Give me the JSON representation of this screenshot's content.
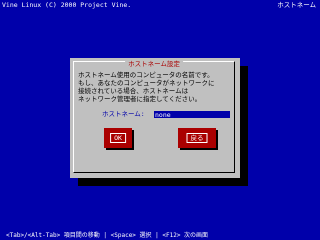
{
  "top_bar": {
    "left_text": "Vine Linux (C) 2000 Project Vine.",
    "right_text": "ホストネーム"
  },
  "dialog": {
    "title": "ホストネーム設定",
    "message": "ホストネーム使用のコンピュータの名前です。\nもし、あなたのコンピュータがネットワークに\n接続されている場合、ホストネームは\nネットワーク管理者に指定してください。",
    "hostname_label": "ホストネーム:",
    "hostname_value": "none",
    "ok_label": "OK",
    "back_label": "戻る"
  },
  "bottom_bar": {
    "text": "<Tab>/<Alt-Tab> 項目間の移動 | <Space> 選択 | <F12> 次の画面"
  },
  "colors": {
    "background": "#0000aa",
    "dialog": "#c0c0c0",
    "title": "#aa0000",
    "button": "#aa0000",
    "input": "#0000aa"
  }
}
